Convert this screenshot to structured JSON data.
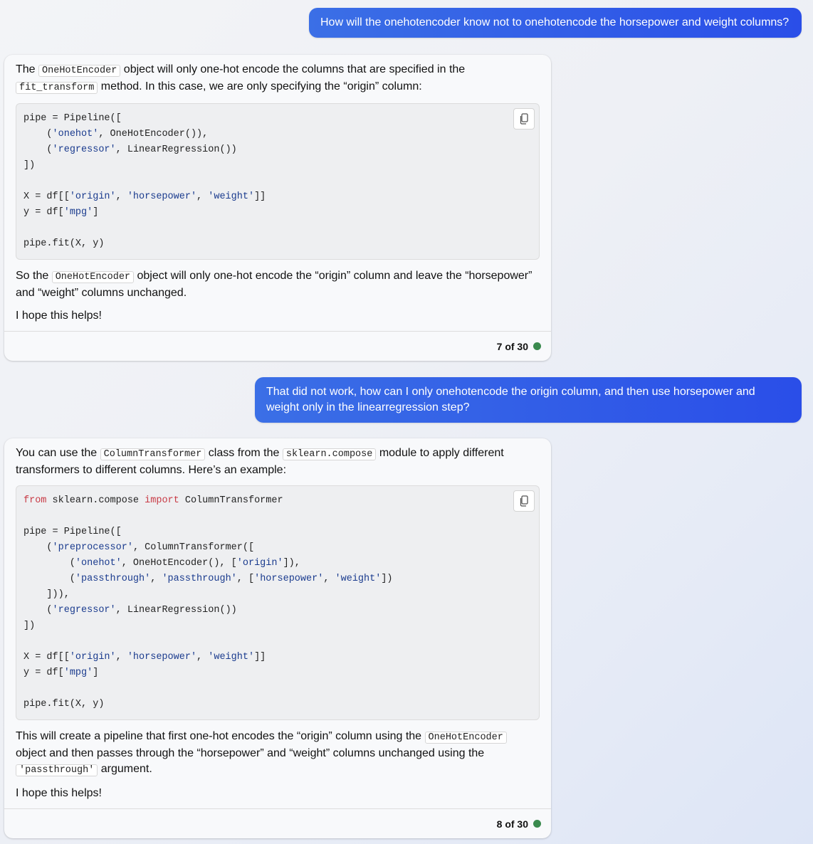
{
  "messages": [
    {
      "role": "user",
      "text": "How will the onehotencoder know not to onehotencode the horsepower and weight columns?"
    },
    {
      "role": "bot",
      "intro": {
        "p1": "The ",
        "c1": "OneHotEncoder",
        "p2": " object will only one-hot encode the columns that are specified in the ",
        "c2": "fit_transform",
        "p3": " method. In this case, we are only specifying the “origin” column:"
      },
      "code": [
        "pipe = Pipeline([",
        "    ('onehot', OneHotEncoder()),",
        "    ('regressor', LinearRegression())",
        "])",
        "",
        "X = df[['origin', 'horsepower', 'weight']]",
        "y = df['mpg']",
        "",
        "pipe.fit(X, y)"
      ],
      "after": {
        "p1": "So the ",
        "c1": "OneHotEncoder",
        "p2": " object will only one-hot encode the “origin” column and leave the “horsepower” and “weight” columns unchanged."
      },
      "closing": "I hope this helps!",
      "counter": "7 of 30"
    },
    {
      "role": "user",
      "text": "That did not work, how can I only onehotencode the origin column, and then use horsepower and weight only in the linearregression step?"
    },
    {
      "role": "bot",
      "intro": {
        "p1": "You can use the ",
        "c1": "ColumnTransformer",
        "p2": " class from the ",
        "c2": "sklearn.compose",
        "p3": " module to apply different transformers to different columns. Here’s an example:"
      },
      "code": [
        "from sklearn.compose import ColumnTransformer",
        "",
        "pipe = Pipeline([",
        "    ('preprocessor', ColumnTransformer([",
        "        ('onehot', OneHotEncoder(), ['origin']),",
        "        ('passthrough', 'passthrough', ['horsepower', 'weight'])",
        "    ])),",
        "    ('regressor', LinearRegression())",
        "])",
        "",
        "X = df[['origin', 'horsepower', 'weight']]",
        "y = df['mpg']",
        "",
        "pipe.fit(X, y)"
      ],
      "after": {
        "p1": "This will create a pipeline that first one-hot encodes the “origin” column using the ",
        "c1": "OneHotEncoder",
        "p2": " object and then passes through the “horsepower” and “weight” columns unchanged using the ",
        "c2": "'passthrough'",
        "p3": " argument."
      },
      "closing": "I hope this helps!",
      "counter": "8 of 30"
    }
  ],
  "icons": {
    "copy": "copy-icon",
    "status": "status-dot"
  },
  "colors": {
    "user_bubble_start": "#3b6fe6",
    "user_bubble_end": "#2a4ee8",
    "keyword": "#c83a45",
    "string": "#1a3b8e",
    "status_dot": "#3a8a4e"
  }
}
